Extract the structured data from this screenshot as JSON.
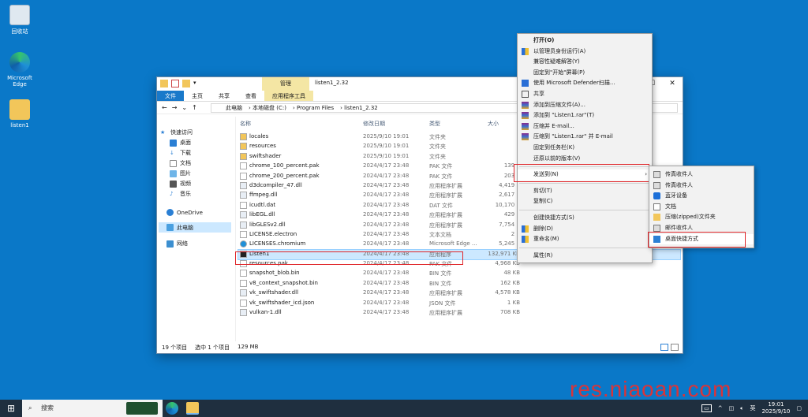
{
  "desktop": {
    "icons": [
      {
        "label": "回收站",
        "name": "recycle-bin"
      },
      {
        "label": "Microsoft Edge",
        "name": "edge"
      },
      {
        "label": "listen1",
        "name": "listen1-folder"
      }
    ]
  },
  "window": {
    "title": "listen1_2.32",
    "contextual_tab": "管理",
    "ribbon_tabs": [
      "文件",
      "主页",
      "共享",
      "查看",
      "应用程序工具"
    ],
    "breadcrumb": [
      "此电脑",
      "本地磁盘 (C:)",
      "Program Files",
      "listen1_2.32"
    ],
    "nav": {
      "quick_access": "快速访问",
      "items": [
        "桌面",
        "下载",
        "文档",
        "图片",
        "视频",
        "音乐"
      ],
      "onedrive": "OneDrive",
      "this_pc": "此电脑",
      "network": "网络"
    },
    "columns": {
      "name": "名称",
      "date": "修改日期",
      "type": "类型",
      "size": "大小"
    },
    "files": [
      {
        "name": "locales",
        "date": "2025/9/10 19:01",
        "type": "文件夹",
        "size": "",
        "icon": "folder"
      },
      {
        "name": "resources",
        "date": "2025/9/10 19:01",
        "type": "文件夹",
        "size": "",
        "icon": "folder"
      },
      {
        "name": "swiftshader",
        "date": "2025/9/10 19:01",
        "type": "文件夹",
        "size": "",
        "icon": "folder"
      },
      {
        "name": "chrome_100_percent.pak",
        "date": "2024/4/17 23:48",
        "type": "PAK 文件",
        "size": "139 K",
        "icon": "file"
      },
      {
        "name": "chrome_200_percent.pak",
        "date": "2024/4/17 23:48",
        "type": "PAK 文件",
        "size": "203 K",
        "icon": "file"
      },
      {
        "name": "d3dcompiler_47.dll",
        "date": "2024/4/17 23:48",
        "type": "应用程序扩展",
        "size": "4,419 K",
        "icon": "dll"
      },
      {
        "name": "ffmpeg.dll",
        "date": "2024/4/17 23:48",
        "type": "应用程序扩展",
        "size": "2,617 K",
        "icon": "dll"
      },
      {
        "name": "icudtl.dat",
        "date": "2024/4/17 23:48",
        "type": "DAT 文件",
        "size": "10,170 K",
        "icon": "file"
      },
      {
        "name": "libEGL.dll",
        "date": "2024/4/17 23:48",
        "type": "应用程序扩展",
        "size": "429 K",
        "icon": "dll"
      },
      {
        "name": "libGLESv2.dll",
        "date": "2024/4/17 23:48",
        "type": "应用程序扩展",
        "size": "7,754 K",
        "icon": "dll"
      },
      {
        "name": "LICENSE.electron",
        "date": "2024/4/17 23:48",
        "type": "文本文档",
        "size": "2 K",
        "icon": "file"
      },
      {
        "name": "LICENSES.chromium",
        "date": "2024/4/17 23:48",
        "type": "Microsoft Edge ...",
        "size": "5,245 K",
        "icon": "edge"
      },
      {
        "name": "Listen1",
        "date": "2024/4/17 23:48",
        "type": "应用程序",
        "size": "132,971 KB",
        "icon": "app"
      },
      {
        "name": "resources.pak",
        "date": "2024/4/17 23:48",
        "type": "PAK 文件",
        "size": "4,968 KB",
        "icon": "file"
      },
      {
        "name": "snapshot_blob.bin",
        "date": "2024/4/17 23:48",
        "type": "BIN 文件",
        "size": "48 KB",
        "icon": "file"
      },
      {
        "name": "v8_context_snapshot.bin",
        "date": "2024/4/17 23:48",
        "type": "BIN 文件",
        "size": "162 KB",
        "icon": "file"
      },
      {
        "name": "vk_swiftshader.dll",
        "date": "2024/4/17 23:48",
        "type": "应用程序扩展",
        "size": "4,578 KB",
        "icon": "dll"
      },
      {
        "name": "vk_swiftshader_icd.json",
        "date": "2024/4/17 23:48",
        "type": "JSON 文件",
        "size": "1 KB",
        "icon": "file"
      },
      {
        "name": "vulkan-1.dll",
        "date": "2024/4/17 23:48",
        "type": "应用程序扩展",
        "size": "708 KB",
        "icon": "dll"
      }
    ],
    "status": {
      "count": "19 个项目",
      "selected": "选中 1 个项目",
      "size": "129 MB"
    }
  },
  "context_menu": {
    "items": [
      {
        "label": "打开(O)",
        "bold": true,
        "icon": ""
      },
      {
        "label": "以管理员身份运行(A)",
        "icon": "shield"
      },
      {
        "label": "兼容性疑难解答(Y)",
        "icon": ""
      },
      {
        "label": "固定到\"开始\"屏幕(P)",
        "icon": ""
      },
      {
        "label": "使用 Microsoft Defender扫描...",
        "icon": "defender"
      },
      {
        "label": "共享",
        "icon": "share"
      },
      {
        "label": "添加到压缩文件(A)...",
        "icon": "rar"
      },
      {
        "label": "添加到 \"Listen1.rar\"(T)",
        "icon": "rar"
      },
      {
        "label": "压缩并 E-mail...",
        "icon": "rar"
      },
      {
        "label": "压缩到 \"Listen1.rar\" 并 E-mail",
        "icon": "rar"
      },
      {
        "label": "固定到任务栏(K)",
        "icon": ""
      },
      {
        "label": "还原以前的版本(V)",
        "icon": ""
      },
      {
        "sep": true
      },
      {
        "label": "发送到(N)",
        "icon": "",
        "submenu": true,
        "highlight": true
      },
      {
        "sep": true
      },
      {
        "label": "剪切(T)",
        "icon": ""
      },
      {
        "label": "复制(C)",
        "icon": ""
      },
      {
        "sep": true
      },
      {
        "label": "创建快捷方式(S)",
        "icon": ""
      },
      {
        "label": "删除(D)",
        "icon": "shield"
      },
      {
        "label": "重命名(M)",
        "icon": "shield"
      },
      {
        "sep": true
      },
      {
        "label": "属性(R)",
        "icon": ""
      }
    ]
  },
  "sendto_menu": {
    "items": [
      {
        "label": "传真收件人",
        "icon": "fax"
      },
      {
        "label": "传真收件人",
        "icon": "fax"
      },
      {
        "label": "蓝牙设备",
        "icon": "bluetooth"
      },
      {
        "label": "文档",
        "icon": "doc"
      },
      {
        "label": "压缩(zipped)文件夹",
        "icon": "zip"
      },
      {
        "label": "邮件收件人",
        "icon": "mail"
      },
      {
        "label": "桌面快捷方式",
        "icon": "desktop",
        "highlight": true
      }
    ]
  },
  "taskbar": {
    "search_placeholder": "搜索",
    "ime": "英",
    "time": "19:01",
    "date": "2025/9/10"
  },
  "watermark": "res.niaoan.com",
  "colors": {
    "accent": "#1979ca",
    "selection": "#cce8ff",
    "highlight_box": "#e0262a",
    "desktop": "#0a78c8",
    "taskbar": "#1f2f3f"
  }
}
